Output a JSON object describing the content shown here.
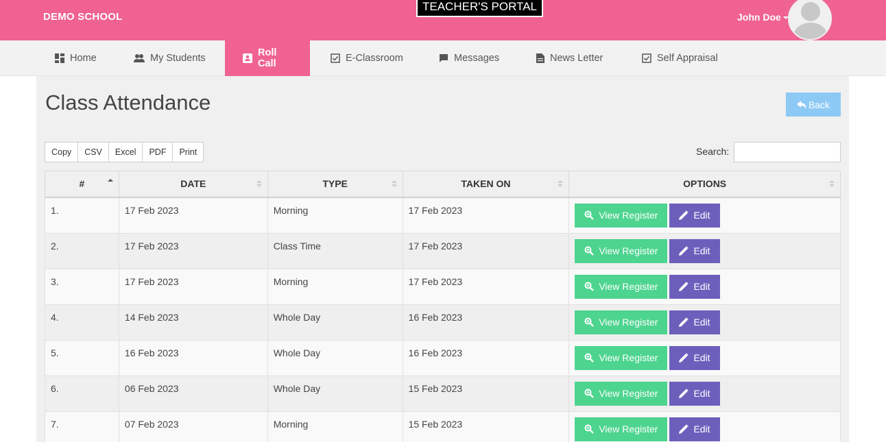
{
  "header": {
    "brand": "DEMO SCHOOL",
    "portal_label": "TEACHER'S PORTAL",
    "user_name": "John Doe",
    "brand_color": "#f06292"
  },
  "nav": {
    "items": [
      {
        "label": "Home",
        "icon": "dashboard-icon"
      },
      {
        "label": "My Students",
        "icon": "people-icon"
      },
      {
        "label": "Roll Call",
        "icon": "roll-call-icon",
        "active": true
      },
      {
        "label": "E-Classroom",
        "icon": "checkbox-icon"
      },
      {
        "label": "Messages",
        "icon": "chat-icon"
      },
      {
        "label": "News Letter",
        "icon": "document-icon"
      },
      {
        "label": "Self Appraisal",
        "icon": "checkbox-icon"
      }
    ]
  },
  "page": {
    "title": "Class Attendance",
    "back_label": "Back"
  },
  "toolbar": {
    "export_buttons": [
      "Copy",
      "CSV",
      "Excel",
      "PDF",
      "Print"
    ],
    "search_label": "Search:",
    "search_value": ""
  },
  "table": {
    "columns": [
      "#",
      "DATE",
      "TYPE",
      "TAKEN ON",
      "OPTIONS"
    ],
    "view_label": "View Register",
    "edit_label": "Edit",
    "rows": [
      {
        "num": "1.",
        "date": "17 Feb 2023",
        "type": "Morning",
        "taken_on": "17 Feb 2023"
      },
      {
        "num": "2.",
        "date": "17 Feb 2023",
        "type": "Class Time",
        "taken_on": "17 Feb 2023"
      },
      {
        "num": "3.",
        "date": "17 Feb 2023",
        "type": "Morning",
        "taken_on": "17 Feb 2023"
      },
      {
        "num": "4.",
        "date": "14 Feb 2023",
        "type": "Whole Day",
        "taken_on": "16 Feb 2023"
      },
      {
        "num": "5.",
        "date": "16 Feb 2023",
        "type": "Whole Day",
        "taken_on": "16 Feb 2023"
      },
      {
        "num": "6.",
        "date": "06 Feb 2023",
        "type": "Whole Day",
        "taken_on": "15 Feb 2023"
      },
      {
        "num": "7.",
        "date": "07 Feb 2023",
        "type": "Morning",
        "taken_on": "15 Feb 2023"
      }
    ]
  }
}
